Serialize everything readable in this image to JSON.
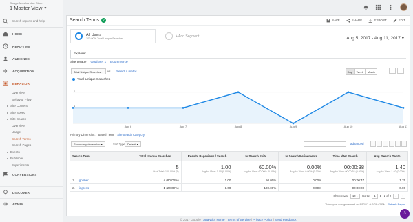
{
  "account": {
    "property": "Google Merchandise Store",
    "view": "1 Master View"
  },
  "search": {
    "placeholder": "Search reports and help"
  },
  "nav": {
    "home": "HOME",
    "realtime": "REAL-TIME",
    "audience": "AUDIENCE",
    "acquisition": "ACQUISITION",
    "behavior": "BEHAVIOR",
    "behavior_items": [
      "Overview",
      "Behavior Flow",
      "Site Content",
      "Site Speed",
      "Site Search",
      "Overview",
      "Usage",
      "Search Terms",
      "Search Pages",
      "Events",
      "Publisher",
      "Experiments"
    ],
    "conversions": "CONVERSIONS",
    "discover": "DISCOVER",
    "admin": "ADMIN"
  },
  "report": {
    "title": "Search Terms",
    "actions": [
      "SAVE",
      "SHARE",
      "EXPORT",
      "EDIT"
    ],
    "segment_name": "All Users",
    "segment_sub": "100.00% Total Unique Searches",
    "add_segment": "+ Add Segment",
    "date_range": "Aug 5, 2017 - Aug 11, 2017"
  },
  "tabs": {
    "explorer": "Explorer"
  },
  "subtabs": [
    "Site Usage",
    "Goal Set 1",
    "Ecommerce"
  ],
  "controls": {
    "metric": "Total Unique Searches",
    "vs": "vs.",
    "select_metric": "Select a metric",
    "periods": [
      "Day",
      "Week",
      "Month"
    ]
  },
  "chart_data": {
    "type": "line",
    "series": [
      {
        "name": "Total Unique Searches",
        "values": [
          1,
          1,
          1,
          2,
          0,
          2,
          1
        ]
      }
    ],
    "x": [
      "Aug 5",
      "Aug 6",
      "Aug 7",
      "Aug 8",
      "Aug 9",
      "Aug 10",
      "Aug 11"
    ],
    "x_tick_labels": [
      "Aug 6",
      "Aug 7",
      "Aug 8",
      "Aug 9",
      "Aug 10",
      "Aug 11"
    ],
    "y_tick_labels": [
      "1",
      "2"
    ],
    "ylim": [
      0,
      2.3
    ],
    "color": "#1e88e5"
  },
  "dimension": {
    "label": "Primary Dimension:",
    "current": "Search Term",
    "alt": "Site Search Category"
  },
  "table_controls": {
    "secondary": "Secondary dimension",
    "sort_label": "Sort Type:",
    "sort_value": "Default",
    "advanced": "advanced"
  },
  "table": {
    "headers": [
      "Search Term",
      "Total Unique Searches",
      "Results Pageviews / Search",
      "% Search Exits",
      "% Search Refinements",
      "Time after Search",
      "Avg. Search Depth"
    ],
    "totals": [
      {
        "value": "5",
        "sub": "% of Total: 100.00% (5)"
      },
      {
        "value": "1.00",
        "sub": "Avg for View: 1.00 (0.00%)"
      },
      {
        "value": "60.00%",
        "sub": "Avg for View: 60.00% (0.00%)"
      },
      {
        "value": "0.00%",
        "sub": "Avg for View: 0.00% (0.00%)"
      },
      {
        "value": "00:00:38",
        "sub": "Avg for View: 00:00:38 (0.00%)"
      },
      {
        "value": "1.40",
        "sub": "Avg for View: 1.40 (0.00%)"
      }
    ],
    "rows": [
      {
        "idx": "1.",
        "term": "gopher",
        "searches": "4",
        "pct": "(80.00%)",
        "pv": "1.00",
        "exits": "50.00%",
        "ref": "0.00%",
        "time": "00:00:47",
        "depth": "1.75"
      },
      {
        "idx": "2.",
        "term": "ingress",
        "searches": "1",
        "pct": "(20.00%)",
        "pv": "1.00",
        "exits": "100.00%",
        "ref": "0.00%",
        "time": "00:00:00",
        "depth": "0.00"
      }
    ]
  },
  "pager": {
    "show": "Show rows:",
    "rows": "10",
    "goto": "Go to:",
    "page": "1",
    "range": "1 - 2 of 2"
  },
  "report_note": {
    "text": "This report was generated on 8/12/17 at 6:29:42 PM -",
    "link": "Refresh Report"
  },
  "footer": {
    "copyright": "© 2017 Google |",
    "links": [
      "Analytics Home",
      "Terms of Service",
      "Privacy Policy",
      "Send Feedback"
    ]
  },
  "fab": "3"
}
